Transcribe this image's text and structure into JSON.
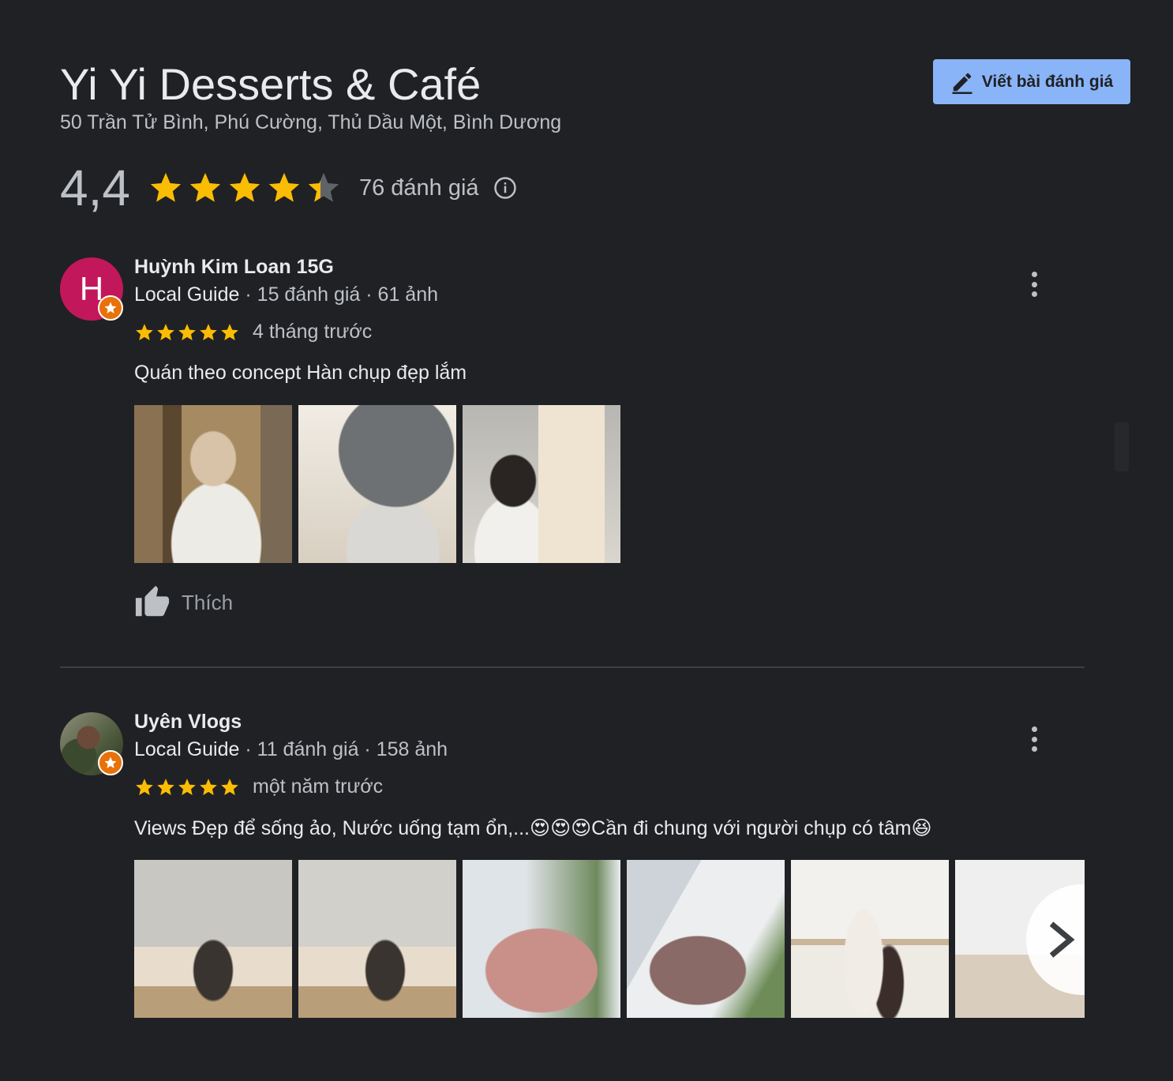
{
  "header": {
    "title": "Yi Yi Desserts & Café",
    "address": "50 Trần Tử Bình, Phú Cường, Thủ Dầu Một, Bình Dương",
    "write_review_label": "Viết bài đánh giá"
  },
  "rating": {
    "value": "4,4",
    "stars": 4.4,
    "count_label": "76 đánh giá",
    "info_icon": "info-icon"
  },
  "reviews": [
    {
      "avatar_letter": "H",
      "name": "Huỳnh Kim Loan 15G",
      "guide_label": "Local Guide",
      "meta": "· 15 đánh giá · 61 ảnh",
      "stars": 5,
      "time": "4 tháng trước",
      "text": "Quán theo concept Hàn chụp đẹp lắm",
      "photo_count": 3,
      "like_label": "Thích"
    },
    {
      "avatar_letter": "",
      "name": "Uyên Vlogs",
      "guide_label": "Local Guide",
      "meta": "· 11 đánh giá · 158 ảnh",
      "stars": 5,
      "time": "một năm trước",
      "text": "Views Đẹp để sống ảo, Nước uống tạm ổn,...😍😍😍Cần đi chung với người chụp có tâm😆",
      "photo_count": 6
    }
  ],
  "colors": {
    "background": "#202124",
    "accent_button": "#8ab4f8",
    "star": "#fbbc04",
    "star_empty": "#5f6368",
    "avatar_bg": "#c2185b",
    "guide_badge": "#e8710a"
  }
}
